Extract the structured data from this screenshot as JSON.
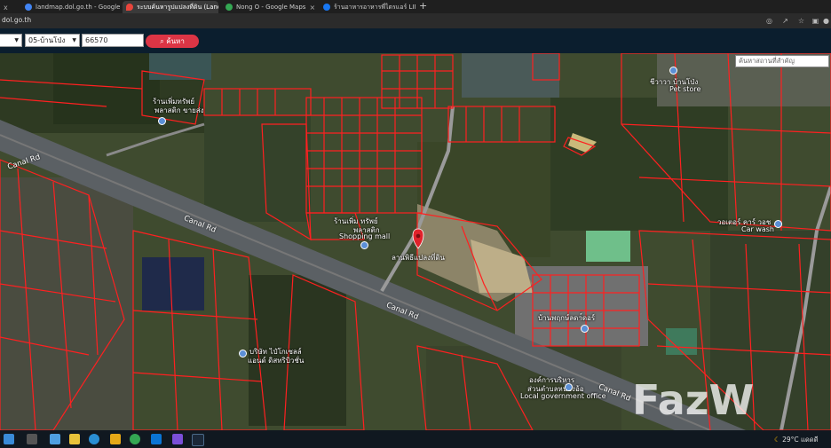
{
  "tabs": [
    {
      "label": "x",
      "color": "#888"
    },
    {
      "label": "landmap.dol.go.th - Google Sea",
      "color": "#4285f4"
    },
    {
      "label": "ระบบค้นหารูปแปลงที่ดิน (LandsMap",
      "color": "#e8453c"
    },
    {
      "label": "Nong O - Google Maps",
      "color": "#34a853"
    },
    {
      "label": "ร้านอาหารอาหารพี่ไตรแอร์ LINEMAN GM",
      "color": "#1877f2"
    }
  ],
  "url": "dol.go.th",
  "search": {
    "province_value": "",
    "district_value": "05-บ้านโป่ง",
    "zip_value": "66570",
    "button_label": "ค้นหา",
    "place_placeholder": "ค้นหาสถานที่สำคัญ"
  },
  "map": {
    "labels": [
      {
        "text": "ร้านเพิ่มทรัพย์",
        "id": "poi-shop-top"
      },
      {
        "text": "พลาสติก ขายส่ง",
        "id": "poi-shop-top-2"
      },
      {
        "text": "ร้านเพิ่ม ทรัพย์",
        "id": "poi-mall"
      },
      {
        "text": "พลาสติก",
        "id": "poi-mall-2"
      },
      {
        "text": "Shopping mall",
        "id": "poi-mall-3"
      },
      {
        "text": "ลานพิธีแปลงที่ดิน",
        "id": "marker-label"
      },
      {
        "text": "ชีวาวา บ้านโป่ง",
        "id": "poi-pet"
      },
      {
        "text": "Pet store",
        "id": "poi-pet-2"
      },
      {
        "text": "วอเตอร์ คาร์ วอช",
        "id": "poi-carwash"
      },
      {
        "text": "Car wash",
        "id": "poi-carwash-2"
      },
      {
        "text": "บ้านพฤกษ์ลดา์ดอร์",
        "id": "poi-village"
      },
      {
        "text": "บริษัท ไป๋โกเซลล์",
        "id": "poi-company"
      },
      {
        "text": "แอนด์ ดิสทริบิวชั่น",
        "id": "poi-company-2"
      },
      {
        "text": "องค์การบริหาร",
        "id": "poi-gov"
      },
      {
        "text": "ส่วนตำบลหนองอ้อ",
        "id": "poi-gov-2"
      },
      {
        "text": "Local government office",
        "id": "poi-gov-3"
      }
    ],
    "roads": [
      "Canal Rd",
      "Canal Rd",
      "Canal Rd",
      "Canal Rd"
    ],
    "watermark": "FazW"
  },
  "taskbar": {
    "weather": "29°C",
    "weather_desc": "แดดดี"
  }
}
